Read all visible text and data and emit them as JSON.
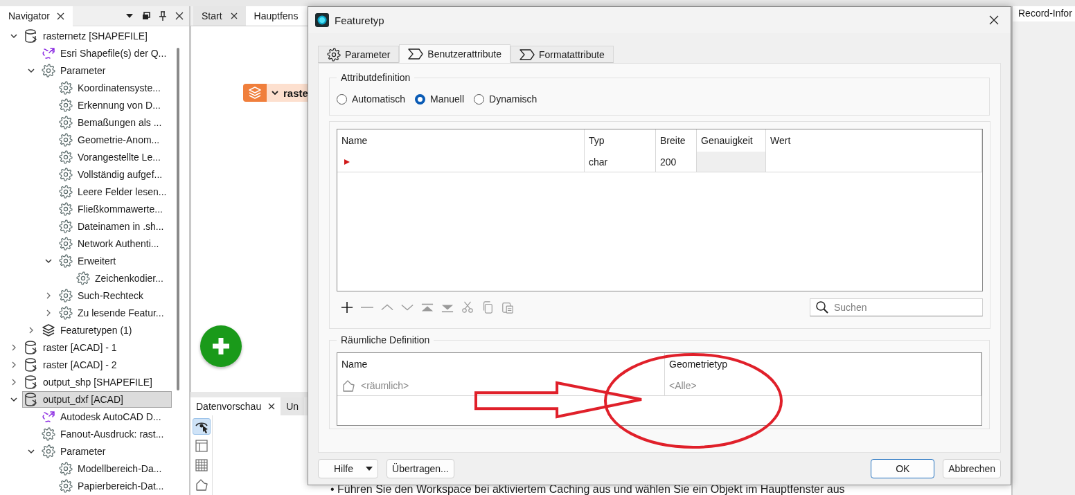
{
  "navigator": {
    "title": "Navigator",
    "tree": [
      {
        "label": "rasternetz [SHAPEFILE]",
        "kind": "database",
        "selected": false,
        "expanded": true,
        "children": [
          {
            "label": "Esri Shapefile(s) der Q...",
            "kind": "link",
            "selected": false
          },
          {
            "label": "Parameter",
            "kind": "gear",
            "selected": false,
            "expanded": true,
            "children": [
              {
                "label": "Koordinatensyste...",
                "kind": "gear",
                "selected": false
              },
              {
                "label": "Erkennung von D...",
                "kind": "gear",
                "selected": false
              },
              {
                "label": "Bemaßungen als ...",
                "kind": "gear",
                "selected": false
              },
              {
                "label": "Geometrie-Anom...",
                "kind": "gear",
                "selected": false
              },
              {
                "label": "Vorangestellte Le...",
                "kind": "gear",
                "selected": false
              },
              {
                "label": "Vollständig aufgef...",
                "kind": "gear",
                "selected": false
              },
              {
                "label": "Leere Felder lesen...",
                "kind": "gear",
                "selected": false
              },
              {
                "label": "Fließkommawerte...",
                "kind": "gear",
                "selected": false
              },
              {
                "label": "Dateinamen in .sh...",
                "kind": "gear",
                "selected": false
              },
              {
                "label": "Network Authenti...",
                "kind": "gear",
                "selected": false
              },
              {
                "label": "Erweitert",
                "kind": "gear",
                "selected": false,
                "expanded": true,
                "children": [
                  {
                    "label": "Zeichenkodier...",
                    "kind": "gear",
                    "selected": false
                  }
                ]
              },
              {
                "label": "Such-Rechteck",
                "kind": "gear",
                "selected": false,
                "expanded": false
              },
              {
                "label": "Zu lesende Featur...",
                "kind": "gear",
                "selected": false,
                "expanded": false
              }
            ]
          },
          {
            "label": "Featuretypen (1)",
            "kind": "layers",
            "selected": false,
            "expanded": false
          }
        ]
      },
      {
        "label": "raster [ACAD] - 1",
        "kind": "database",
        "selected": false,
        "expanded": false
      },
      {
        "label": "raster [ACAD] - 2",
        "kind": "database",
        "selected": false,
        "expanded": false
      },
      {
        "label": "output_shp [SHAPEFILE]",
        "kind": "database",
        "selected": false,
        "expanded": false
      },
      {
        "label": "output_dxf [ACAD]",
        "kind": "database",
        "selected": true,
        "expanded": true,
        "children": [
          {
            "label": "Autodesk AutoCAD D...",
            "kind": "link",
            "selected": false
          },
          {
            "label": "Fanout-Ausdruck: rast...",
            "kind": "gear",
            "selected": false
          },
          {
            "label": "Parameter",
            "kind": "gear",
            "selected": false,
            "expanded": true,
            "children": [
              {
                "label": "Modellbereich-Da...",
                "kind": "gear",
                "selected": false
              },
              {
                "label": "Papierbereich-Dat...",
                "kind": "gear",
                "selected": false
              }
            ]
          }
        ]
      }
    ]
  },
  "editor_tabs": [
    {
      "label": "Start",
      "closable": true,
      "selected": false
    },
    {
      "label": "Hauptfens",
      "closable": false,
      "selected": true
    }
  ],
  "canvas": {
    "node": {
      "label": "raste"
    }
  },
  "bottom_panel": {
    "tabs": [
      {
        "label": "Datenvorschau",
        "closable": true,
        "selected": true
      },
      {
        "label": "Un",
        "closable": false,
        "selected": false
      }
    ],
    "tools": [
      {
        "kind": "inspect",
        "selected": true
      },
      {
        "kind": "layout",
        "selected": false
      },
      {
        "kind": "table",
        "selected": false
      },
      {
        "kind": "geometry",
        "selected": false
      }
    ],
    "hint": "• Führen Sie den Workspace bei aktiviertem Caching aus und wählen Sie ein Objekt im Hauptfenster aus"
  },
  "right_panel": {
    "tab": "Record-Infor"
  },
  "dialog": {
    "title": "Featuretyp",
    "tabs": [
      {
        "label": "Parameter",
        "kind": "gear",
        "selected": false
      },
      {
        "label": "Benutzerattribute",
        "kind": "sigma",
        "selected": true
      },
      {
        "label": "Formatattribute",
        "kind": "sigma",
        "selected": false
      }
    ],
    "attribute_definition": {
      "title": "Attributdefinition",
      "options": [
        {
          "label": "Automatisch",
          "selected": false
        },
        {
          "label": "Manuell",
          "selected": true
        },
        {
          "label": "Dynamisch",
          "selected": false
        }
      ]
    },
    "attributes_table": {
      "columns": [
        "Name",
        "Typ",
        "Breite",
        "Genauigkeit",
        "Wert"
      ],
      "rows": [
        {
          "current": true,
          "cells": [
            {
              "disabled": false
            },
            {
              "text": "char",
              "disabled": false
            },
            {
              "text": "200",
              "disabled": false
            },
            {
              "disabled": true
            },
            {
              "disabled": false
            }
          ]
        }
      ]
    },
    "toolbar": [
      {
        "kind": "add",
        "disabled": false
      },
      {
        "kind": "remove",
        "disabled": true
      },
      {
        "kind": "up",
        "disabled": true
      },
      {
        "kind": "down",
        "disabled": true
      },
      {
        "kind": "top",
        "disabled": true
      },
      {
        "kind": "bottom",
        "disabled": true
      },
      {
        "kind": "cut",
        "disabled": true
      },
      {
        "kind": "copy",
        "disabled": true
      },
      {
        "kind": "paste",
        "disabled": true
      }
    ],
    "search": {
      "placeholder": "Suchen"
    },
    "spatial_definition": {
      "title": "Räumliche Definition",
      "columns": [
        "Name",
        "Geometrietyp"
      ],
      "rows": [
        {
          "cells": [
            {
              "text": "<räumlich>",
              "greyed": true,
              "kind": "geometry"
            },
            {
              "text": "<Alle>",
              "greyed": true,
              "kind": "text"
            }
          ]
        }
      ]
    },
    "annotations": [
      {
        "kind": "arrow"
      },
      {
        "kind": "ellipse"
      }
    ],
    "left_buttons": [
      {
        "label": "Hilfe",
        "kind": "dropdown"
      },
      {
        "label": "Übertragen...",
        "kind": "plain"
      }
    ],
    "right_buttons": [
      {
        "label": "OK",
        "kind": "default"
      },
      {
        "label": "Abbrechen",
        "kind": "plain"
      }
    ]
  }
}
